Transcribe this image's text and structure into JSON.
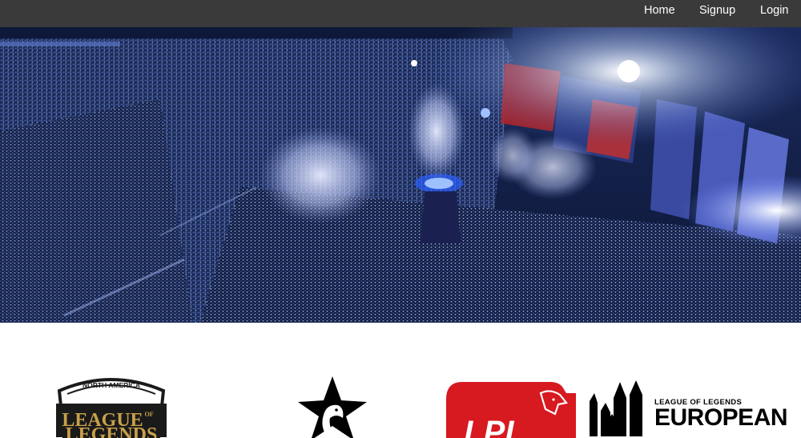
{
  "nav": {
    "links": [
      {
        "label": "Home"
      },
      {
        "label": "Signup"
      },
      {
        "label": "Login"
      }
    ]
  },
  "hero": {
    "image": "esports-arena-crowd-confetti"
  },
  "logos": {
    "lcs": {
      "top_text": "NORTH AMERICA",
      "main_text_1": "LEAGUE",
      "main_text_2": "LEGENDS",
      "of_text": "OF"
    },
    "star_logo": {
      "icon": "star-eagle-icon"
    },
    "lpl": {
      "text": "LPL"
    },
    "lec": {
      "line1": "LEAGUE OF LEGENDS",
      "line2": "EUROPEAN"
    }
  },
  "colors": {
    "navbar": "#3a3a3a",
    "lpl_red": "#d71920",
    "lcs_gold": "#c9a04a"
  }
}
